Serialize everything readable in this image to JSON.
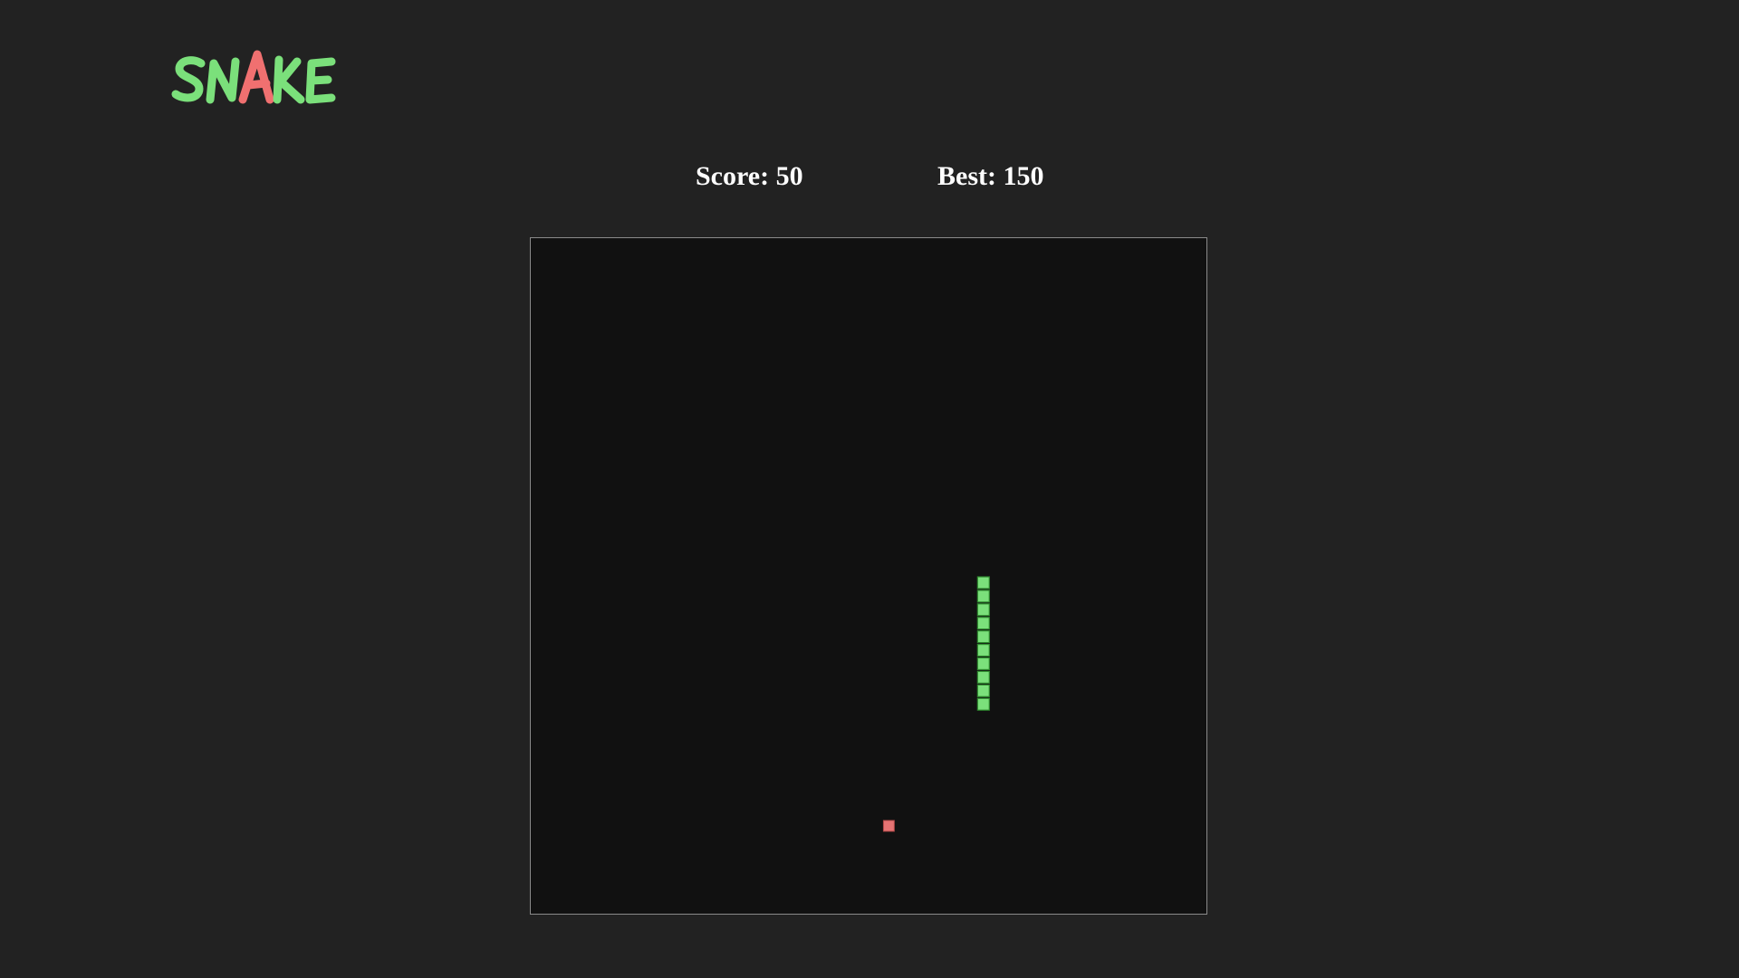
{
  "app": {
    "logo_text": "SNAKE",
    "logo_colors": {
      "primary": "#7be07b",
      "accent": "#f07070"
    }
  },
  "scores": {
    "score_label": "Score: 50",
    "best_label": "Best: 150"
  },
  "game": {
    "grid": {
      "cols": 50,
      "rows": 50
    },
    "colors": {
      "board": "#111111",
      "snake_fill": "#7be07b",
      "snake_stroke": "#2f8a2f",
      "food": "#e57373"
    },
    "snake": [
      [
        33,
        25
      ],
      [
        33,
        26
      ],
      [
        33,
        27
      ],
      [
        33,
        28
      ],
      [
        33,
        29
      ],
      [
        33,
        30
      ],
      [
        33,
        31
      ],
      [
        33,
        32
      ],
      [
        33,
        33
      ],
      [
        33,
        34
      ]
    ],
    "food": [
      26,
      43
    ]
  }
}
